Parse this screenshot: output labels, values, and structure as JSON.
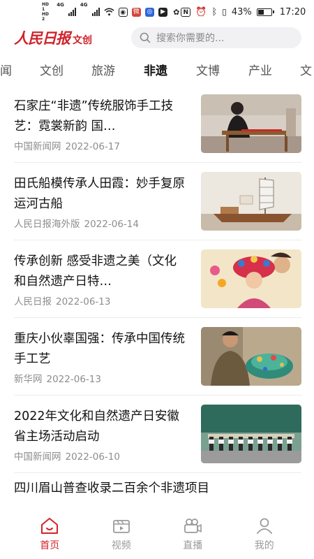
{
  "status_bar": {
    "hd1": "HD 1",
    "hd2": "HD 2",
    "network": "4G",
    "battery_percent": "43%",
    "battery_level": 0.43,
    "time": "17:20"
  },
  "header": {
    "logo_main": "人民日报",
    "logo_sub": "文创",
    "search_placeholder": "搜索你需要的..."
  },
  "tabs": [
    {
      "label": "闻"
    },
    {
      "label": "文创"
    },
    {
      "label": "旅游"
    },
    {
      "label": "非遗",
      "active": true
    },
    {
      "label": "文博"
    },
    {
      "label": "产业"
    },
    {
      "label": "文"
    }
  ],
  "articles": [
    {
      "title": "石家庄“非遗”传统服饰手工技艺：霓裳新韵 国…",
      "source": "中国新闻网",
      "date": "2022-06-17",
      "image": "artisan-at-loom"
    },
    {
      "title": "田氏船模传承人田霞：妙手复原运河古船",
      "source": "人民日报海外版",
      "date": "2022-06-14",
      "image": "ship-model"
    },
    {
      "title": "传承创新 感受非遗之美（文化和自然遗产日特…",
      "source": "人民日报",
      "date": "2022-06-13",
      "image": "opera-headdress-child"
    },
    {
      "title": "重庆小伙辜国强：传承中国传统手工艺",
      "source": "新华网",
      "date": "2022-06-13",
      "image": "craftsman-with-ornament"
    },
    {
      "title": "2022年文化和自然遗产日安徽省主场活动启动",
      "source": "中国新闻网",
      "date": "2022-06-10",
      "image": "stage-ceremony"
    },
    {
      "title": "四川眉山普查收录二百余个非遗项目"
    }
  ],
  "bottom_nav": [
    {
      "label": "首页",
      "icon": "home-icon",
      "active": true
    },
    {
      "label": "视频",
      "icon": "video-icon"
    },
    {
      "label": "直播",
      "icon": "camera-icon"
    },
    {
      "label": "我的",
      "icon": "person-icon"
    }
  ],
  "colors": {
    "brand_red": "#d0242b",
    "meta_gray": "#8d8d8d",
    "nav_gray": "#9a9a9a"
  }
}
